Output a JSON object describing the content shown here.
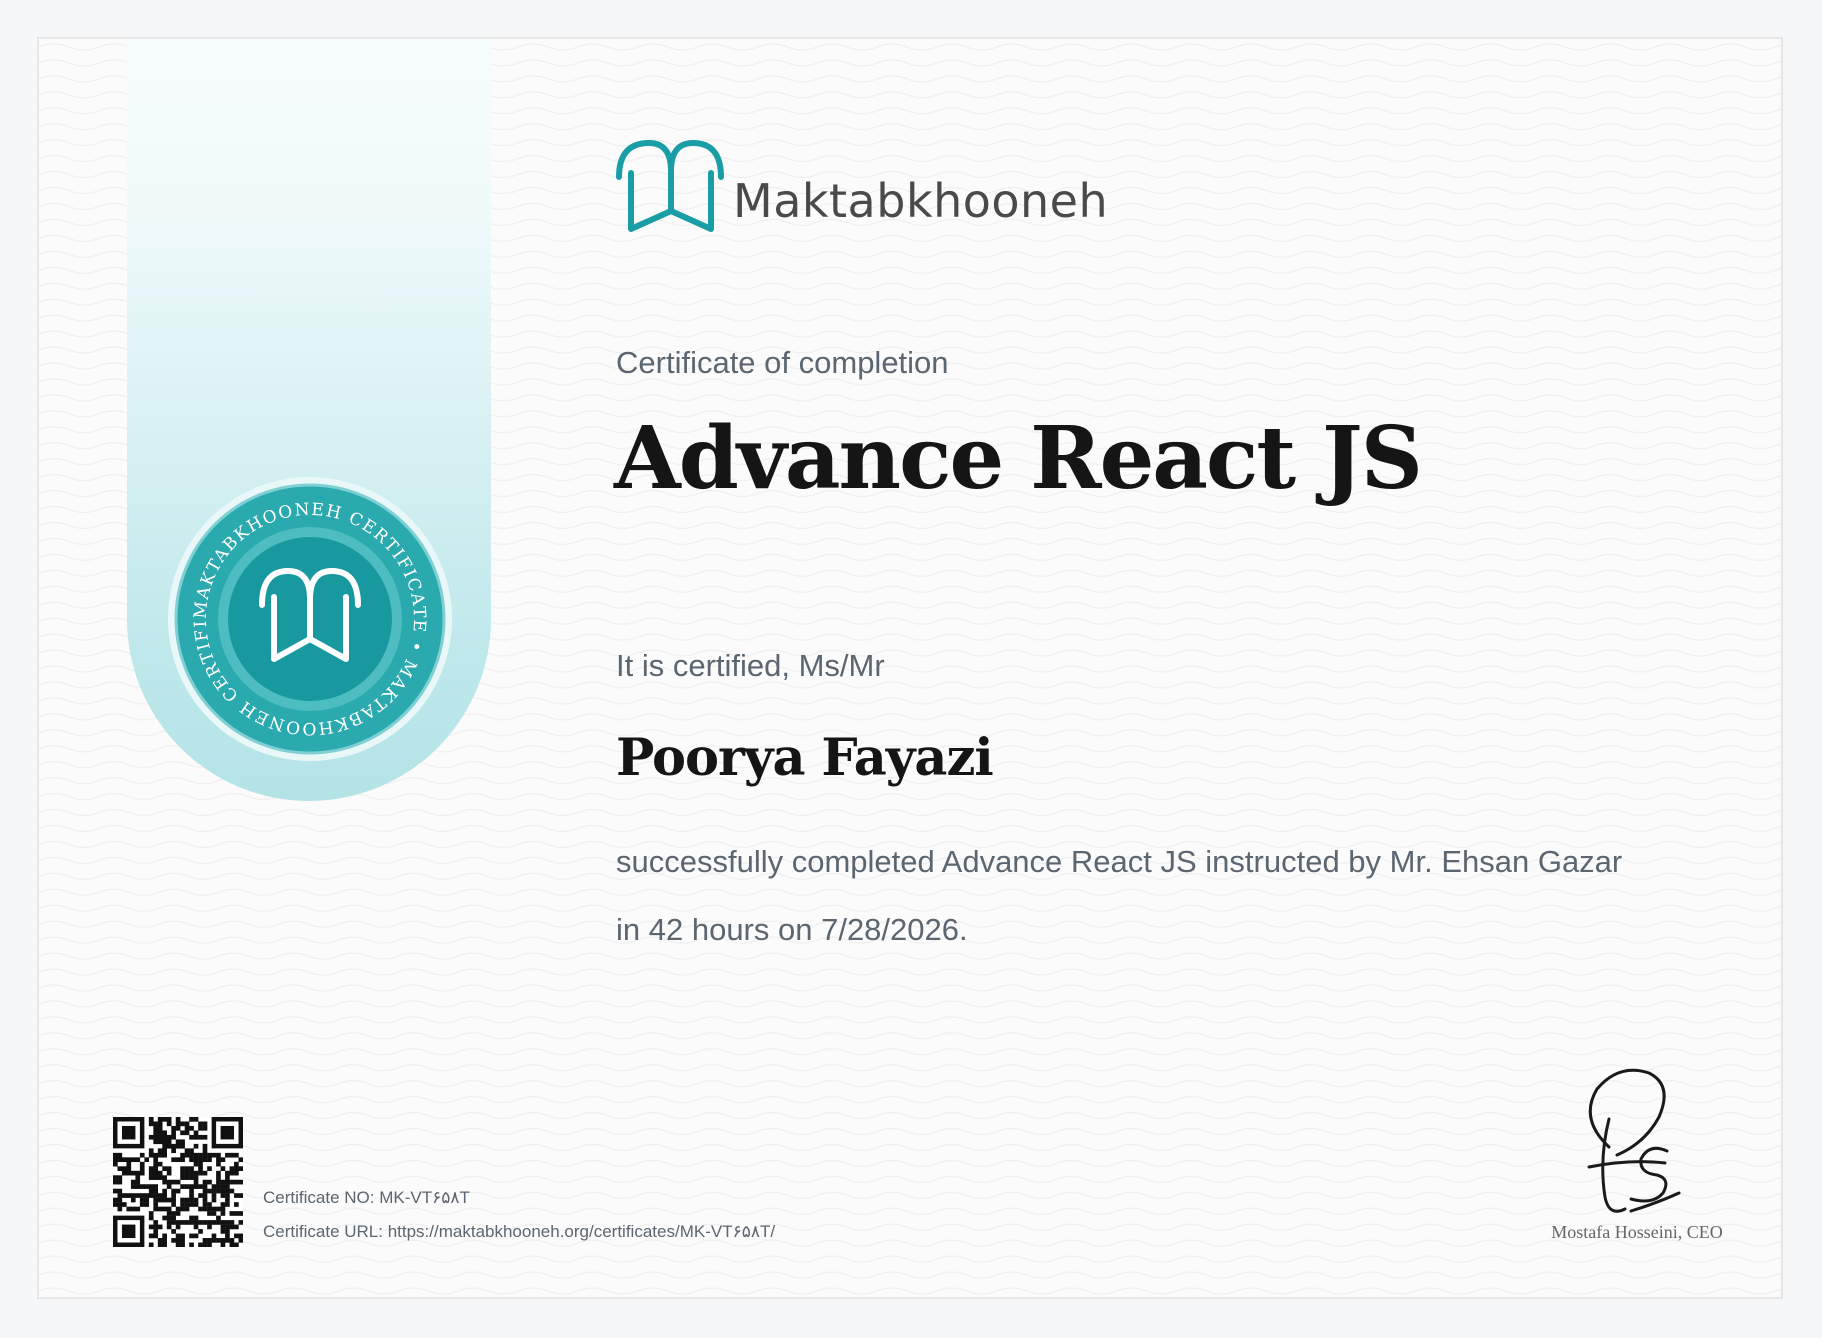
{
  "brand": {
    "name": "Maktabkhooneh",
    "color": "#1a9ea6"
  },
  "certificate": {
    "label": "Certificate of completion",
    "course_title": "Advance React JS",
    "certified_label": "It is certified, Ms/Mr",
    "recipient_name": "Poorya Fayazi",
    "completion_line_1": "successfully completed Advance React JS instructed by Mr. Ehsan Gazar",
    "completion_line_2": "in 42 hours on 7/28/2026.",
    "number_line": "Certificate NO: MK-VT۶۵۸T",
    "url_line": "Certificate URL: https://maktabkhooneh.org/certificates/MK-VT۶۵۸T/"
  },
  "seal": {
    "ring_text": "MAKTABKHOONEH CERTIFICATE • MAKTABKHOONEH CERTIFICATE •"
  },
  "signature": {
    "signer": "Mostafa Hosseini, CEO"
  },
  "colors": {
    "teal": "#1a9ea6",
    "teal_light": "#5cc4c8",
    "ribbon_light": "#bfe8eb",
    "text_dark": "#151515",
    "text_muted": "#5c6670"
  },
  "icons": {
    "logo": "maktabkhooneh-logo",
    "seal": "certificate-seal",
    "qr": "qr-code",
    "signature": "handwritten-signature"
  }
}
